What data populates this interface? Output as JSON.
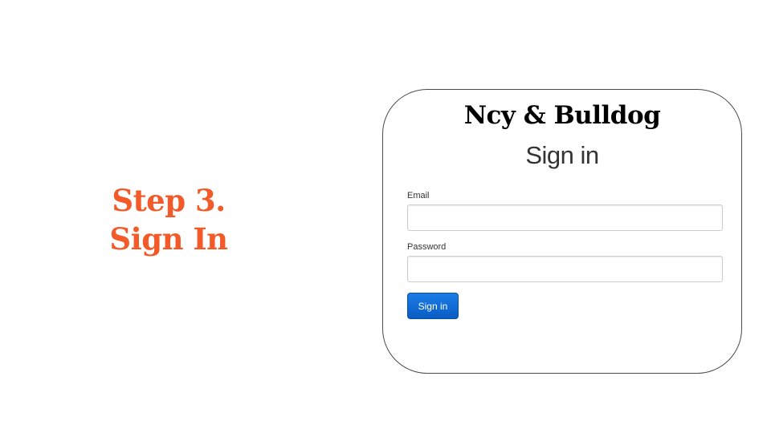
{
  "slide": {
    "step_line1": "Step 3.",
    "step_line2": "Sign In"
  },
  "login_card": {
    "brand": "Ncy & Bulldog",
    "title": "Sign in",
    "email_label": "Email",
    "email_value": "",
    "password_label": "Password",
    "password_value": "",
    "submit_label": "Sign in"
  },
  "colors": {
    "step_title": "#f25a29",
    "submit_button": "#0a5cc4",
    "card_border": "#4a4a4a"
  }
}
